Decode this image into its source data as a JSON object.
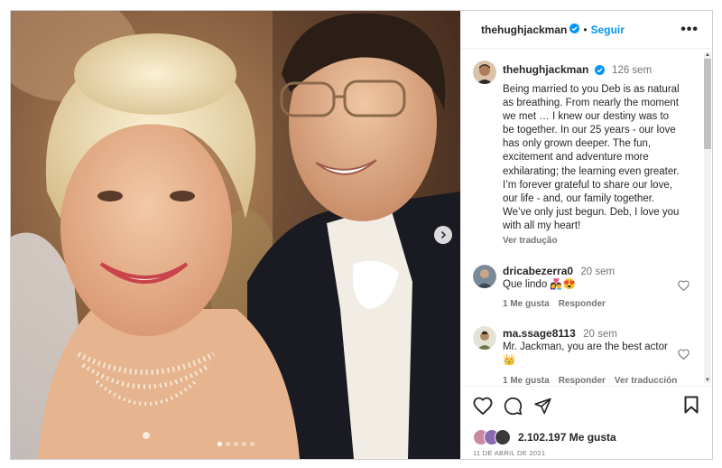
{
  "post": {
    "username": "thehughjackman",
    "follow_label": "Seguir",
    "more_label": "•••",
    "separator": "•",
    "carousel_count": 5,
    "carousel_active": 0
  },
  "caption": {
    "username": "thehughjackman",
    "time": "126 sem",
    "text": "Being married to you Deb is as natural as breathing. From nearly the moment we met … I knew our destiny was to be together. In our 25 years - our love has only grown deeper. The fun, excitement and adventure more exhilarating; the learning even greater. I’m forever grateful to share our love, our life - and, our family together. We’ve only just begun. Deb, I love you with all my heart!",
    "translate_label": "Ver tradução"
  },
  "comments": [
    {
      "username": "dricabezerra0",
      "time": "20 sem",
      "text": "Que lindo 👩‍❤️‍👨😍",
      "likes_label": "1 Me gusta",
      "reply_label": "Responder"
    },
    {
      "username": "ma.ssage8113",
      "time": "20 sem",
      "text": "Mr. Jackman, you are the best actor 👑",
      "likes_label": "1 Me gusta",
      "reply_label": "Responder",
      "translate_label": "Ver traducción"
    }
  ],
  "footer": {
    "likes": "2.102.197 Me gusta",
    "date": "11 DE ABRIL DE 2021"
  },
  "colors": {
    "link_blue": "#0095f6",
    "verified_blue": "#0095f6",
    "secondary_text": "#737373"
  },
  "icons": [
    "verified-badge-icon",
    "more-options-icon",
    "next-arrow-icon",
    "heart-icon",
    "comment-icon",
    "share-icon",
    "bookmark-icon"
  ]
}
